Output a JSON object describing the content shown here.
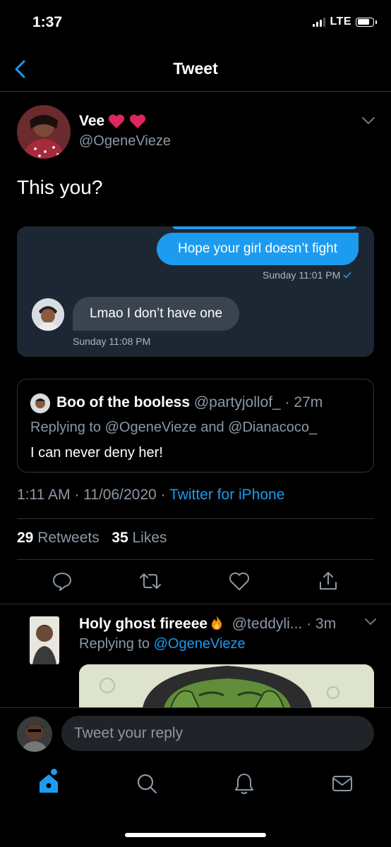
{
  "status_bar": {
    "time": "1:37",
    "network": "LTE"
  },
  "nav": {
    "title": "Tweet"
  },
  "tweet": {
    "author_name": "Vee",
    "author_handle": "@OgeneVieze",
    "text": "This you?",
    "embedded_dm": {
      "outgoing_message": "Hope your girl doesn’t fight",
      "outgoing_time": "Sunday 11:01 PM",
      "incoming_message": "Lmao I don’t have one",
      "incoming_time": "Sunday 11:08 PM"
    },
    "quoted": {
      "author_name": "Boo of the booless",
      "author_handle": "@partyjollof_",
      "age": "· 27m",
      "replying_prefix": "Replying to",
      "replying_user1": "@OgeneVieze",
      "replying_and": "and",
      "replying_user2": "@Dianacoco_",
      "text": "I can never deny her!"
    },
    "timestamp": "1:11 AM · 11/06/2020 ·",
    "source": "Twitter for iPhone",
    "retweets_count": "29",
    "retweets_label": "Retweets",
    "likes_count": "35",
    "likes_label": "Likes"
  },
  "reply": {
    "author_name": "Holy ghost fireeee",
    "author_handle": "@teddyli...",
    "age": "· 3m",
    "replying_prefix": "Replying to",
    "replying_user": "@OgeneVieze"
  },
  "composer": {
    "placeholder": "Tweet your reply"
  },
  "colors": {
    "accent": "#1d9bf0",
    "background": "#000000",
    "secondary_text": "#8b98a5",
    "divider": "#2f3336"
  },
  "icons": [
    "back-icon",
    "chevron-down-icon",
    "heart-emoji-icon",
    "fire-emoji-icon",
    "read-check-icon",
    "reply-icon",
    "retweet-icon",
    "like-icon",
    "share-icon",
    "home-icon",
    "search-icon",
    "notifications-icon",
    "messages-icon"
  ]
}
